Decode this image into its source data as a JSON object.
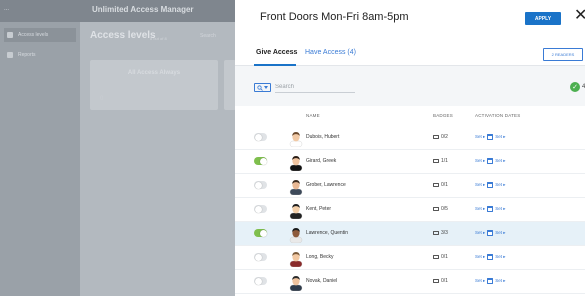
{
  "background": {
    "app_title": "Unlimited Access Manager",
    "user_label": "...",
    "sidebar_items": [
      {
        "label": "Access levels"
      },
      {
        "label": "Reports"
      }
    ],
    "heading": "Access levels",
    "count_label": "8 out of 8",
    "search_label": "Search",
    "cards": [
      {
        "title": "All Access Always",
        "count": "0"
      },
      {
        "title": "",
        "count": ""
      }
    ]
  },
  "modal": {
    "title": "Front Doors Mon-Fri 8am-5pm",
    "apply_label": "APPLY",
    "close_glyph": "✕",
    "tabs": [
      {
        "label": "Give Access"
      },
      {
        "label": "Have Access (4)"
      }
    ],
    "readers_label": "2 READERS",
    "search": {
      "placeholder": "Search",
      "value": ""
    },
    "selected_count": "4",
    "selected_suffix": "sel",
    "columns": {
      "name": "NAME",
      "badges": "BADGES",
      "dates": "ACTIVATION DATES"
    },
    "set_label": "Set",
    "rows": [
      {
        "name": "Dubois, Hubert",
        "badges": "0/2",
        "on": false
      },
      {
        "name": "Girard, Greek",
        "badges": "1/1",
        "on": true
      },
      {
        "name": "Grober, Lawrence",
        "badges": "0/1",
        "on": false
      },
      {
        "name": "Kent, Peter",
        "badges": "0/5",
        "on": false
      },
      {
        "name": "Lawrence, Quentin",
        "badges": "3/3",
        "on": true
      },
      {
        "name": "Long, Becky",
        "badges": "0/1",
        "on": false
      },
      {
        "name": "Novak, Daniel",
        "badges": "0/1",
        "on": false
      }
    ]
  },
  "colors": {
    "accent": "#1a73c8",
    "toggle_on": "#7fbf4d",
    "check": "#4caf50",
    "selected_row": "#e6f1f8"
  }
}
